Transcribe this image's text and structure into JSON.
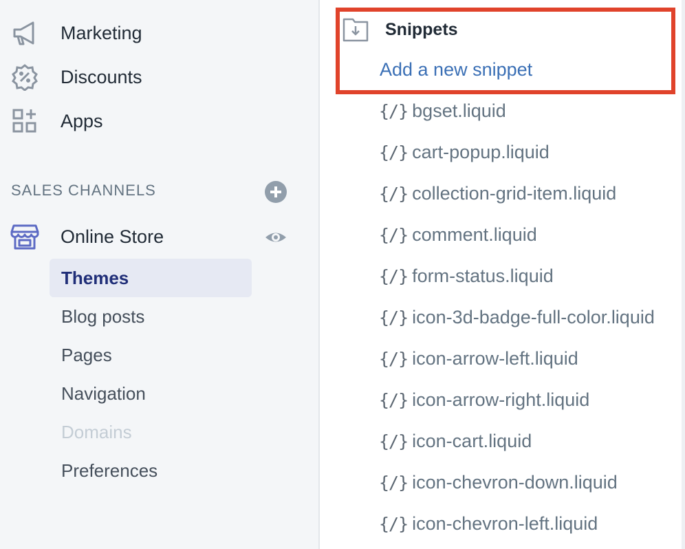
{
  "sidebar": {
    "nav": [
      {
        "label": "Marketing",
        "icon": "megaphone-icon"
      },
      {
        "label": "Discounts",
        "icon": "discount-badge-icon"
      },
      {
        "label": "Apps",
        "icon": "apps-grid-icon"
      }
    ],
    "sales_channels_title": "SALES CHANNELS",
    "online_store": {
      "label": "Online Store",
      "icon": "store-icon"
    },
    "sub_items": [
      {
        "label": "Themes",
        "state": "active"
      },
      {
        "label": "Blog posts",
        "state": "normal"
      },
      {
        "label": "Pages",
        "state": "normal"
      },
      {
        "label": "Navigation",
        "state": "normal"
      },
      {
        "label": "Domains",
        "state": "disabled"
      },
      {
        "label": "Preferences",
        "state": "normal"
      }
    ]
  },
  "editor": {
    "folder_title": "Snippets",
    "add_link": "Add a new snippet",
    "files": [
      "bgset.liquid",
      "cart-popup.liquid",
      "collection-grid-item.liquid",
      "comment.liquid",
      "form-status.liquid",
      "icon-3d-badge-full-color.liquid",
      "icon-arrow-left.liquid",
      "icon-arrow-right.liquid",
      "icon-cart.liquid",
      "icon-chevron-down.liquid",
      "icon-chevron-left.liquid"
    ],
    "file_icon_glyph": "{/}"
  },
  "colors": {
    "accent": "#3a6fb5",
    "highlight": "#e0432b",
    "active_bg": "#e6e9f3",
    "active_text": "#202e78",
    "store_icon": "#5c6ac4"
  }
}
